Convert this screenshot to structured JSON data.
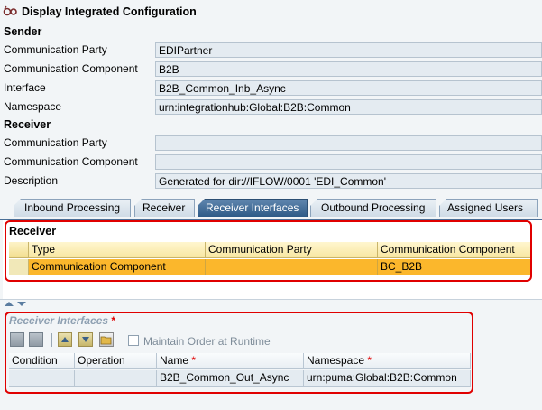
{
  "window": {
    "title": "Display Integrated Configuration",
    "icon": "glasses-display-icon"
  },
  "sender": {
    "heading": "Sender",
    "fields": [
      {
        "label": "Communication Party",
        "value": "EDIPartner"
      },
      {
        "label": "Communication Component",
        "value": "B2B"
      },
      {
        "label": "Interface",
        "value": "B2B_Common_Inb_Async"
      },
      {
        "label": "Namespace",
        "value": "urn:integrationhub:Global:B2B:Common"
      }
    ]
  },
  "receiver": {
    "heading": "Receiver",
    "fields": [
      {
        "label": "Communication Party",
        "value": ""
      },
      {
        "label": "Communication Component",
        "value": ""
      },
      {
        "label": "Description",
        "value": "Generated for dir://IFLOW/0001 'EDI_Common'"
      }
    ]
  },
  "tabs": [
    {
      "label": "Inbound Processing",
      "active": false
    },
    {
      "label": "Receiver",
      "active": false
    },
    {
      "label": "Receiver Interfaces",
      "active": true
    },
    {
      "label": "Outbound Processing",
      "active": false
    },
    {
      "label": "Assigned Users",
      "active": false
    }
  ],
  "receiver_table": {
    "title": "Receiver",
    "columns": [
      "Type",
      "Communication Party",
      "Communication Component"
    ],
    "rows": [
      {
        "type": "Communication Component",
        "party": "",
        "component": "BC_B2B",
        "selected": true
      }
    ]
  },
  "receiver_interfaces": {
    "title": "Receiver Interfaces",
    "required_marker": "*",
    "maintain_order_label": "Maintain Order at Runtime",
    "maintain_order_checked": false,
    "columns": [
      {
        "label": "Condition",
        "required": ""
      },
      {
        "label": "Operation Map...",
        "required": ""
      },
      {
        "label": "Name",
        "required": "*"
      },
      {
        "label": "Namespace",
        "required": "*"
      }
    ],
    "rows": [
      {
        "condition": "",
        "operation_mapping": "",
        "name": "B2B_Common_Out_Async",
        "namespace": "urn:puma:Global:B2B:Common"
      }
    ]
  },
  "colors": {
    "selected_row": "#fbb72c",
    "active_tab": "#2e5a87",
    "highlight_box": "#e00000"
  }
}
